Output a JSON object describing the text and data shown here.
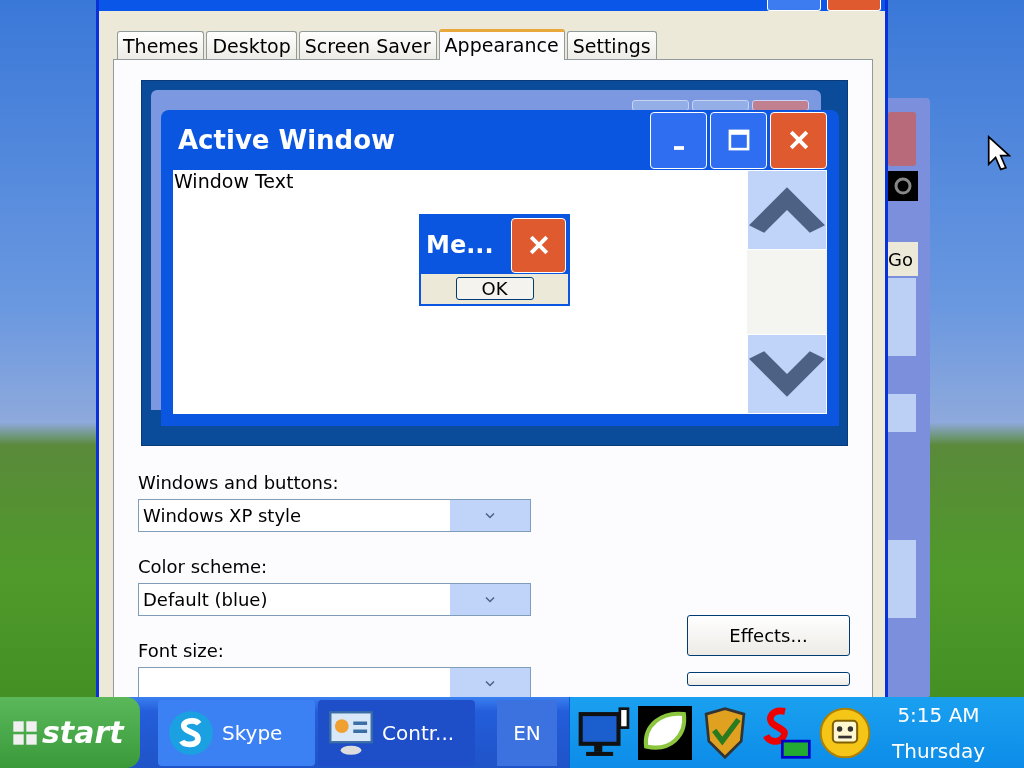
{
  "dialog": {
    "tabs": [
      {
        "label": "Themes",
        "selected": false
      },
      {
        "label": "Desktop",
        "selected": false
      },
      {
        "label": "Screen Saver",
        "selected": false
      },
      {
        "label": "Appearance",
        "selected": true
      },
      {
        "label": "Settings",
        "selected": false
      }
    ],
    "preview": {
      "active_window_title": "Active Window",
      "window_text": "Window Text",
      "message_box": {
        "title": "Me...",
        "button": "OK"
      }
    },
    "settings": [
      {
        "label": "Windows and buttons:",
        "value": "Windows XP style"
      },
      {
        "label": "Color scheme:",
        "value": "Default (blue)"
      },
      {
        "label": "Font size:"
      }
    ],
    "buttons": [
      "Effects..."
    ]
  },
  "background_window": {
    "button": "Go"
  },
  "taskbar": {
    "start": "start",
    "tasks": [
      {
        "label": "Skype",
        "selected": false,
        "kind": "skype"
      },
      {
        "label": "Contr...",
        "selected": true,
        "kind": "control-panel"
      }
    ],
    "language": "EN",
    "clock": {
      "time": "5:15 AM",
      "day": "Thursday"
    }
  }
}
